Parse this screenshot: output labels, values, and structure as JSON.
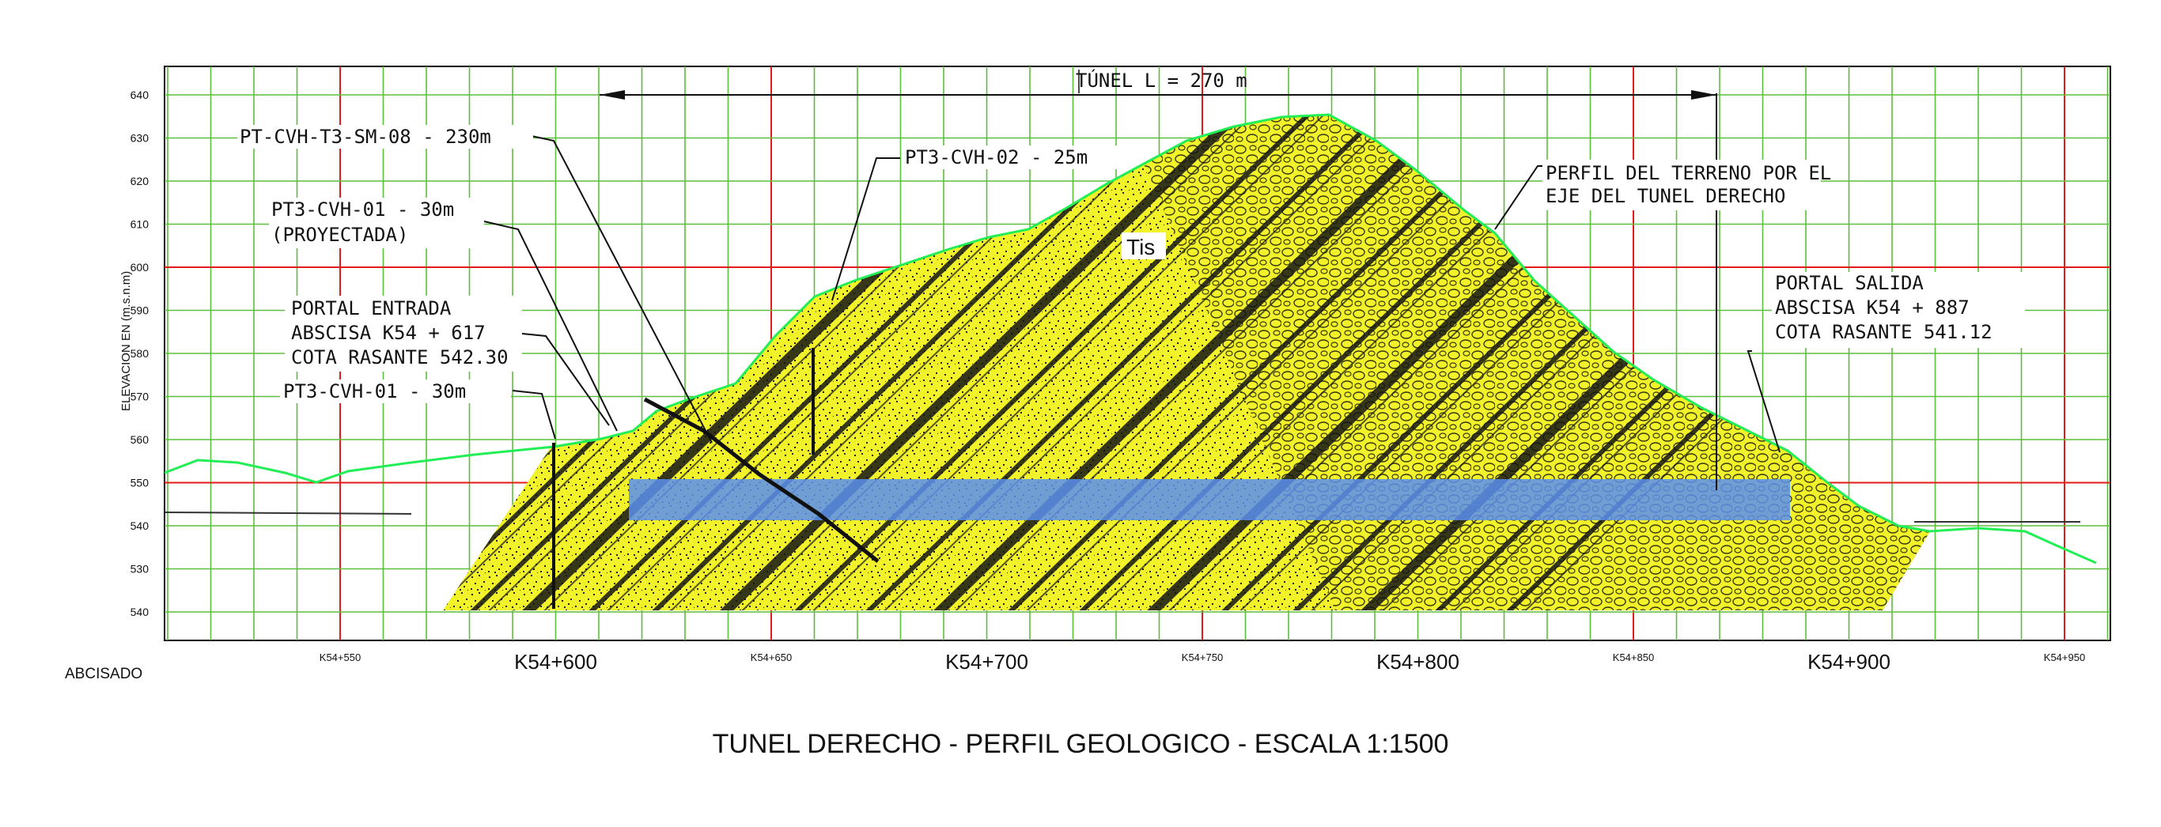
{
  "title": "TUNEL DERECHO - PERFIL GEOLOGICO - ESCALA 1:1500",
  "y_axis_label": "ELEVACION EN (m.s.n.m)",
  "abscisado_label": "ABCISADO",
  "y_ticks": [
    "640",
    "630",
    "620",
    "610",
    "600",
    "590",
    "580",
    "570",
    "560",
    "550",
    "540",
    "530",
    "540"
  ],
  "x_ticks": [
    {
      "label": "K54+550",
      "major": false
    },
    {
      "label": "K54+600",
      "major": true
    },
    {
      "label": "K54+650",
      "major": false
    },
    {
      "label": "K54+700",
      "major": true
    },
    {
      "label": "K54+750",
      "major": false
    },
    {
      "label": "K54+800",
      "major": true
    },
    {
      "label": "K54+850",
      "major": false
    },
    {
      "label": "K54+900",
      "major": true
    },
    {
      "label": "K54+950",
      "major": false
    }
  ],
  "tunnel_length_label": "TÚNEL L = 270 m",
  "formation_label": "Tis",
  "callouts": {
    "sm08": "PT-CVH-T3-SM-08 - 230m",
    "cvh02": "PT3-CVH-02 - 25m",
    "cvh01_proj_1": "PT3-CVH-01 - 30m",
    "cvh01_proj_2": "(PROYECTADA)",
    "portal_in_1": "PORTAL ENTRADA",
    "portal_in_2": "ABSCISA K54 + 617",
    "portal_in_3": "COTA RASANTE 542.30",
    "cvh01": "PT3-CVH-01 - 30m",
    "terrain_1": "PERFIL DEL TERRENO POR EL",
    "terrain_2": "EJE DEL TUNEL DERECHO",
    "portal_out_1": "PORTAL SALIDA",
    "portal_out_2": "ABSCISA K54 + 887",
    "portal_out_3": "COTA RASANTE 541.12"
  },
  "colors": {
    "rock_fill": "#f2f22a",
    "terrain_line": "#22ee55",
    "tunnel": "#5a8ff0",
    "major_grid": "#e41b1b",
    "minor_grid": "#5cbf3c",
    "frame": "#000000"
  }
}
